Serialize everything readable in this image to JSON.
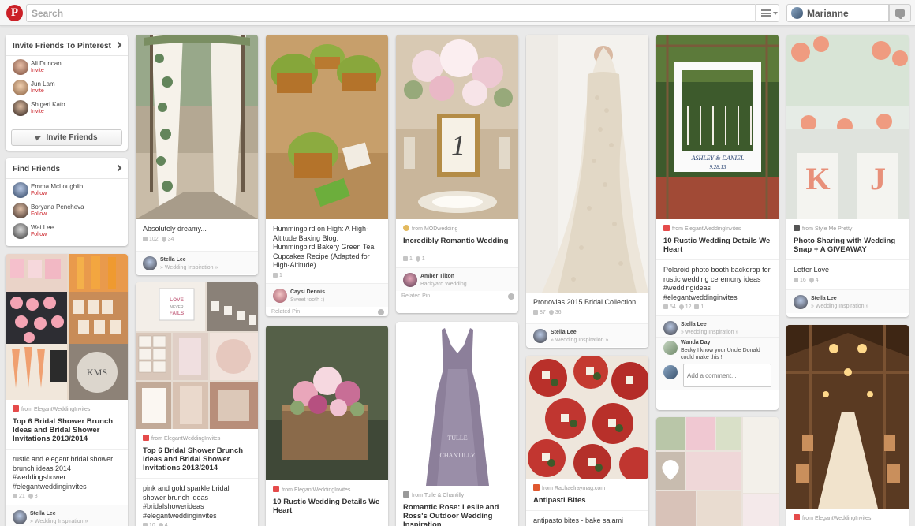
{
  "header": {
    "logo": "P",
    "search_placeholder": "Search",
    "user_name": "Marianne"
  },
  "sidebar": {
    "invite": {
      "title": "Invite Friends To Pinterest",
      "friends": [
        {
          "name": "Ali Duncan",
          "action": "Invite"
        },
        {
          "name": "Jun Lam",
          "action": "Invite"
        },
        {
          "name": "Shigeri Kato",
          "action": "Invite"
        }
      ],
      "button": "Invite Friends"
    },
    "find": {
      "title": "Find Friends",
      "friends": [
        {
          "name": "Emma McLoughlin",
          "action": "Follow"
        },
        {
          "name": "Boryana Pencheva",
          "action": "Follow"
        },
        {
          "name": "Wai Lee",
          "action": "Follow"
        }
      ]
    }
  },
  "pins": [
    {
      "desc": "Absolutely dreamy...",
      "repins": "102",
      "likes": "34",
      "pinner": "Stella Lee",
      "board": "» Wedding Inspiration »"
    },
    {
      "desc": "Hummingbird on High: A High-Altitude Baking Blog: Hummingbird Bakery Green Tea Cupcakes Recipe (Adapted for High-Altitude)",
      "repins": "1",
      "pinner": "Caysi Dennis",
      "board": "Sweet tooth :)",
      "related": "Related Pin"
    },
    {
      "from": "from MODwedding",
      "title": "Incredibly Romantic Wedding",
      "repins": "1",
      "likes": "1",
      "pinner": "Amber Tilton",
      "board": "Backyard Wedding",
      "related": "Related Pin"
    },
    {
      "desc": "Pronovias 2015 Bridal Collection",
      "repins": "87",
      "likes": "36",
      "pinner": "Stella Lee",
      "board": "» Wedding Inspiration »"
    },
    {
      "from": "from ElegantWeddingInvites",
      "title": "10 Rustic Wedding Details We Heart",
      "desc": "Polaroid photo booth backdrop for rustic wedding ceremony ideas #weddingideas #elegantweddinginvites",
      "repins": "54",
      "likes": "12",
      "comments": "1",
      "pinner": "Stella Lee",
      "board": "» Wedding Inspiration »",
      "comment_name": "Wanda Day",
      "comment_text": "Becky I know your Uncle Donald could make this !",
      "comment_placeholder": "Add a comment..."
    },
    {
      "from": "from Style Me Pretty",
      "title": "Photo Sharing with Wedding Snap + A GIVEAWAY",
      "desc": "Letter Love",
      "repins": "16",
      "likes": "4",
      "pinner": "Stella Lee",
      "board": "» Wedding Inspiration »"
    },
    {
      "from": "from ElegantWeddingInvites",
      "title": "Top 6 Bridal Shower Brunch Ideas and Bridal Shower Invitations 2013/2014",
      "desc": "rustic and elegant bridal shower brunch ideas 2014 #weddingshower #elegantweddinginvites",
      "repins": "21",
      "likes": "3",
      "pinner": "Stella Lee",
      "board": "» Wedding Inspiration »"
    },
    {
      "from": "from ElegantWeddingInvites",
      "title": "Top 6 Bridal Shower Brunch Ideas and Bridal Shower Invitations 2013/2014",
      "desc": "pink and gold sparkle bridal shower brunch ideas #bridalshowerideas #elegantweddinginvites",
      "repins": "10",
      "likes": "4"
    },
    {
      "from": "from ElegantWeddingInvites",
      "title": "10 Rustic Wedding Details We Heart"
    },
    {
      "from": "from Tulle & Chantilly",
      "title": "Romantic Rose: Leslie and Ross's Outdoor Wedding Inspiration",
      "img_text_1": "TULLE",
      "img_text_2": "CHANTILLY"
    },
    {
      "from": "from Rachaelraymag.com",
      "title": "Antipasti Bites",
      "desc": "antipasto bites - bake salami slices"
    },
    {
      "from": "from ElegantWeddingInvites"
    }
  ],
  "image_text": {
    "table_number": "1",
    "love_sign": "LOVE NEVER FAILS",
    "names": "ASHLEY & DANIEL",
    "date": "9.28.13",
    "letters": [
      "K",
      "J"
    ],
    "kms": "KMS"
  }
}
